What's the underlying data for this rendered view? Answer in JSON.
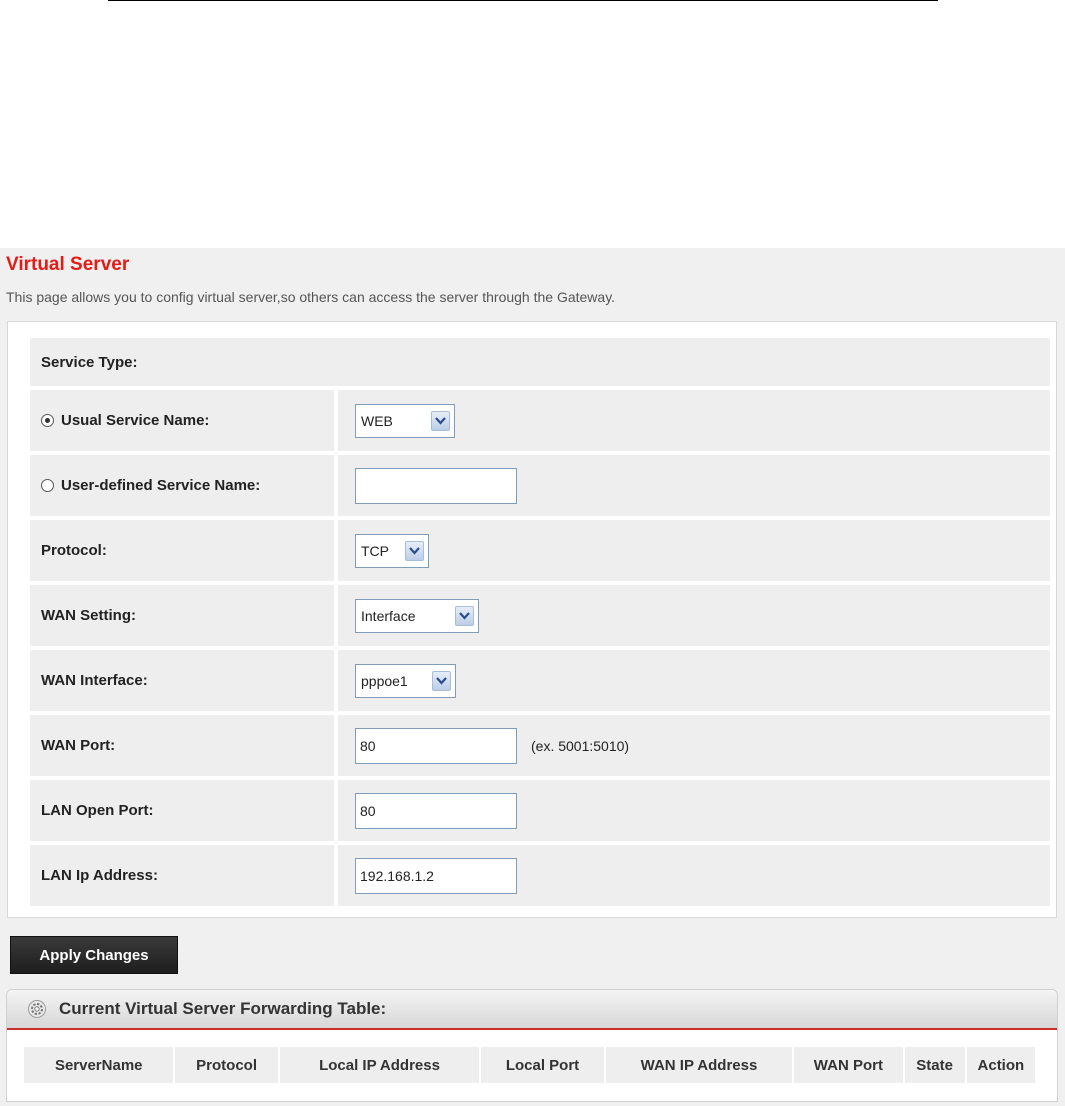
{
  "page": {
    "title": "Virtual Server",
    "description": "This page allows you to config virtual server,so others can access the server through the Gateway."
  },
  "form": {
    "service_type_label": "Service Type:",
    "usual_service": {
      "label": "Usual Service Name:",
      "selected": true,
      "value": "WEB"
    },
    "user_defined_service": {
      "label": "User-defined Service Name:",
      "selected": false,
      "value": ""
    },
    "protocol": {
      "label": "Protocol:",
      "value": "TCP"
    },
    "wan_setting": {
      "label": "WAN Setting:",
      "value": "Interface"
    },
    "wan_interface": {
      "label": "WAN Interface:",
      "value": "pppoe1"
    },
    "wan_port": {
      "label": "WAN Port:",
      "value": "80",
      "hint": "(ex. 5001:5010)"
    },
    "lan_open_port": {
      "label": "LAN Open Port:",
      "value": "80"
    },
    "lan_ip_address": {
      "label": "LAN Ip Address:",
      "value": "192.168.1.2"
    }
  },
  "apply_label": "Apply Changes",
  "table": {
    "title": "Current Virtual Server Forwarding Table:",
    "columns": [
      "ServerName",
      "Protocol",
      "Local IP Address",
      "Local Port",
      "WAN IP Address",
      "WAN Port",
      "State",
      "Action"
    ]
  },
  "icons": {
    "dropdown": "chevron-down-icon",
    "table_header": "gear-icon"
  }
}
